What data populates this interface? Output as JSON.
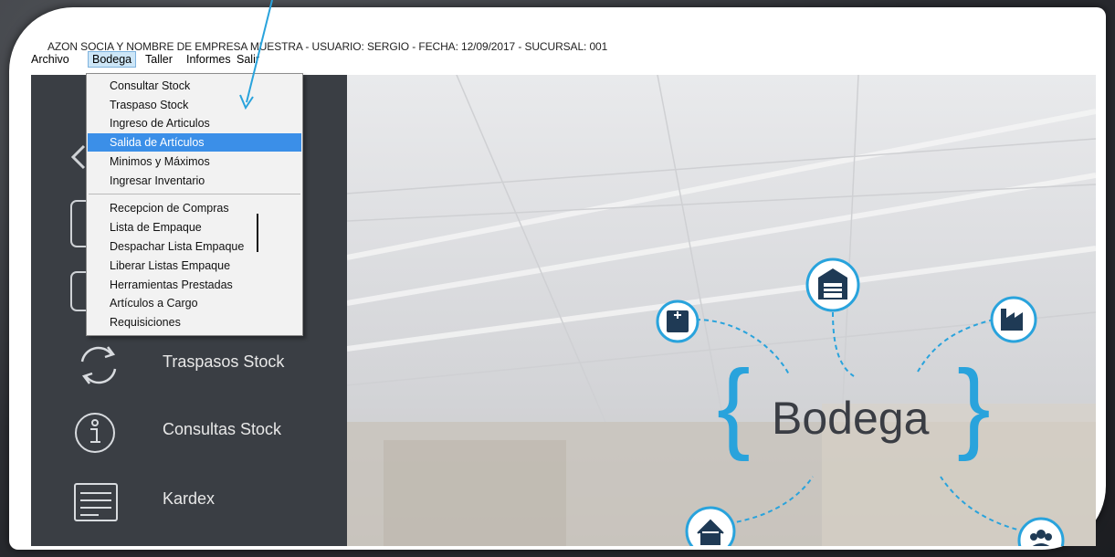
{
  "window": {
    "title": "AZON SOCIA Y NOMBRE DE EMPRESA MUESTRA - USUARIO: SERGIO - FECHA: 12/09/2017 - SUCURSAL: 001"
  },
  "menubar": {
    "items": [
      {
        "label": "Archivo"
      },
      {
        "label": "Bodega"
      },
      {
        "label": "Taller"
      },
      {
        "label": "Informes"
      },
      {
        "label": "Salir"
      }
    ],
    "active_index": 1
  },
  "dropdown": {
    "group1": [
      {
        "label": "Consultar Stock"
      },
      {
        "label": "Traspaso Stock"
      },
      {
        "label": "Ingreso de Articulos"
      },
      {
        "label": "Salida de Artículos"
      },
      {
        "label": "Minimos y Máximos"
      },
      {
        "label": "Ingresar Inventario"
      }
    ],
    "group2": [
      {
        "label": "Recepcion de Compras"
      },
      {
        "label": "Lista de Empaque"
      },
      {
        "label": "Despachar Lista Empaque"
      },
      {
        "label": "Liberar Listas Empaque"
      },
      {
        "label": "Herramientas Prestadas"
      },
      {
        "label": "Artículos a Cargo"
      },
      {
        "label": "Requisiciones"
      }
    ],
    "selected": "Salida de Artículos"
  },
  "sidebar": {
    "items": [
      {
        "label": "Traspasos Stock",
        "icon": "sync-icon"
      },
      {
        "label": "Consultas Stock",
        "icon": "info-icon"
      },
      {
        "label": "Kardex",
        "icon": "document-icon"
      }
    ]
  },
  "hero": {
    "logo_text": "Bodega",
    "icons": [
      "hospital-icon",
      "warehouse-icon",
      "factory-icon",
      "home-icon",
      "users-icon"
    ]
  },
  "colors": {
    "accent": "#29a3dc",
    "selection": "#3b8fe8",
    "sidebar": "#3a3e44",
    "icon_fill": "#1f3a55"
  }
}
